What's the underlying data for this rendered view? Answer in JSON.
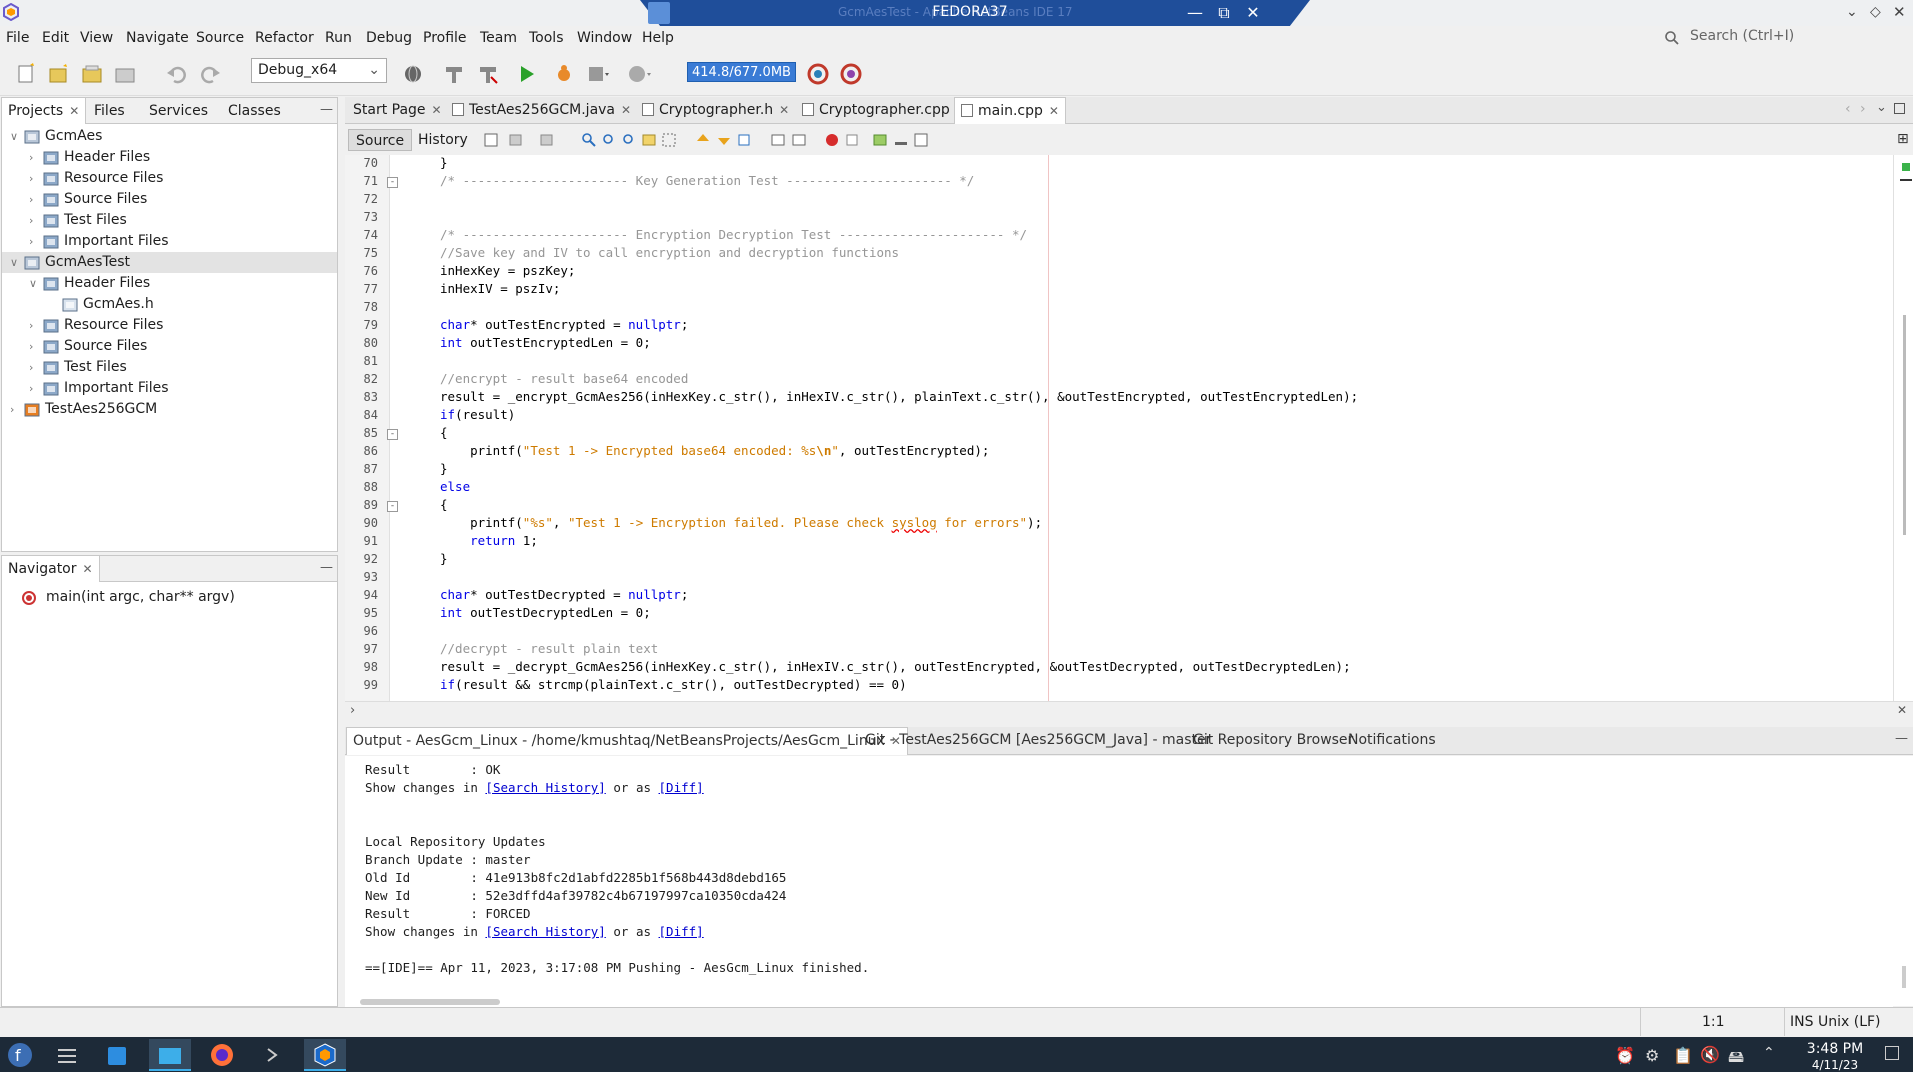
{
  "window": {
    "title": "FEDORA37",
    "title_ghost": "GcmAesTest - Apache NetBeans IDE 17"
  },
  "menubar": {
    "items": [
      "File",
      "Edit",
      "View",
      "Navigate",
      "Source",
      "Refactor",
      "Run",
      "Debug",
      "Profile",
      "Team",
      "Tools",
      "Window",
      "Help"
    ],
    "search_placeholder": "Search (Ctrl+I)"
  },
  "toolbar": {
    "config": "Debug_x64",
    "memory": "414.8/677.0MB"
  },
  "projects_panel": {
    "tabs": [
      "Projects",
      "Files",
      "Services",
      "Classes"
    ],
    "tree": [
      {
        "label": "GcmAes",
        "level": 0,
        "expanded": true,
        "icon": "project-icon"
      },
      {
        "label": "Header Files",
        "level": 1,
        "expanded": false,
        "icon": "folder-icon"
      },
      {
        "label": "Resource Files",
        "level": 1,
        "expanded": false,
        "icon": "folder-icon"
      },
      {
        "label": "Source Files",
        "level": 1,
        "expanded": false,
        "icon": "folder-icon"
      },
      {
        "label": "Test Files",
        "level": 1,
        "expanded": false,
        "icon": "folder-icon"
      },
      {
        "label": "Important Files",
        "level": 1,
        "expanded": false,
        "icon": "folder-icon"
      },
      {
        "label": "GcmAesTest",
        "level": 0,
        "expanded": true,
        "icon": "project-icon",
        "selected": true
      },
      {
        "label": "Header Files",
        "level": 1,
        "expanded": true,
        "icon": "folder-icon"
      },
      {
        "label": "GcmAes.h",
        "level": 2,
        "expanded": null,
        "icon": "header-file-icon"
      },
      {
        "label": "Resource Files",
        "level": 1,
        "expanded": false,
        "icon": "folder-icon"
      },
      {
        "label": "Source Files",
        "level": 1,
        "expanded": false,
        "icon": "folder-icon"
      },
      {
        "label": "Test Files",
        "level": 1,
        "expanded": false,
        "icon": "folder-icon"
      },
      {
        "label": "Important Files",
        "level": 1,
        "expanded": false,
        "icon": "folder-icon"
      },
      {
        "label": "TestAes256GCM",
        "level": 0,
        "expanded": false,
        "icon": "java-project-icon"
      }
    ]
  },
  "navigator_panel": {
    "title": "Navigator",
    "items": [
      "main(int argc, char** argv)"
    ]
  },
  "editor": {
    "tabs": [
      {
        "label": "Start Page"
      },
      {
        "label": "TestAes256GCM.java"
      },
      {
        "label": "Cryptographer.h"
      },
      {
        "label": "Cryptographer.cpp"
      },
      {
        "label": "main.cpp",
        "active": true
      }
    ],
    "source_label": "Source",
    "history_label": "History",
    "lines": [
      {
        "n": "70",
        "html": "}"
      },
      {
        "n": "71",
        "html": "<span class=\"cm\">/* ---------------------- Key Generation Test ---------------------- */</span>",
        "fold": "-"
      },
      {
        "n": "72",
        "html": ""
      },
      {
        "n": "73",
        "html": ""
      },
      {
        "n": "74",
        "html": "<span class=\"cm\">/* ---------------------- Encryption Decryption Test ---------------------- */</span>"
      },
      {
        "n": "75",
        "html": "<span class=\"cm\">//Save key and IV to call encryption and decryption functions</span>"
      },
      {
        "n": "76",
        "html": "inHexKey = pszKey;"
      },
      {
        "n": "77",
        "html": "inHexIV = pszIv;"
      },
      {
        "n": "78",
        "html": ""
      },
      {
        "n": "79",
        "html": "<span class=\"kw\">char</span>* outTestEncrypted = <span class=\"kw\">nullptr</span>;"
      },
      {
        "n": "80",
        "html": "<span class=\"kw\">int</span> outTestEncryptedLen = 0;"
      },
      {
        "n": "81",
        "html": ""
      },
      {
        "n": "82",
        "html": "<span class=\"cm\">//encrypt - result base64 encoded</span>"
      },
      {
        "n": "83",
        "html": "result = _encrypt_GcmAes256(inHexKey.c_str(), inHexIV.c_str(), plainText.c_str(), &amp;outTestEncrypted, outTestEncryptedLen);"
      },
      {
        "n": "84",
        "html": "<span class=\"kw\">if</span>(result)"
      },
      {
        "n": "85",
        "html": "{",
        "fold": "-"
      },
      {
        "n": "86",
        "html": "    printf(<span class=\"str\">\"Test 1 -&gt; Encrypted base64 encoded: %s</span><span class=\"esc\">\\n</span><span class=\"str\">\"</span>, outTestEncrypted);"
      },
      {
        "n": "87",
        "html": "}"
      },
      {
        "n": "88",
        "html": "<span class=\"kw\">else</span>"
      },
      {
        "n": "89",
        "html": "{",
        "fold": "-"
      },
      {
        "n": "90",
        "html": "    printf(<span class=\"str\">\"%s\"</span>, <span class=\"str\">\"Test 1 -&gt; Encryption failed. Please check <span class=\"sq\">syslog</span> for errors\"</span>);"
      },
      {
        "n": "91",
        "html": "    <span class=\"kw\">return</span> 1;"
      },
      {
        "n": "92",
        "html": "}"
      },
      {
        "n": "93",
        "html": ""
      },
      {
        "n": "94",
        "html": "<span class=\"kw\">char</span>* outTestDecrypted = <span class=\"kw\">nullptr</span>;"
      },
      {
        "n": "95",
        "html": "<span class=\"kw\">int</span> outTestDecryptedLen = 0;"
      },
      {
        "n": "96",
        "html": ""
      },
      {
        "n": "97",
        "html": "<span class=\"cm\">//decrypt - result plain text</span>"
      },
      {
        "n": "98",
        "html": "result = _decrypt_GcmAes256(inHexKey.c_str(), inHexIV.c_str(), outTestEncrypted, &amp;outTestDecrypted, outTestDecryptedLen);"
      },
      {
        "n": "99",
        "html": "<span class=\"kw\">if</span>(result &amp;&amp; strcmp(plainText.c_str(), outTestDecrypted) == 0)"
      }
    ]
  },
  "output": {
    "tabs": [
      {
        "label": "Output - AesGcm_Linux - /home/kmushtaq/NetBeansProjects/AesGcm_Linux",
        "active": true
      },
      {
        "label": "Git - TestAes256GCM [Aes256GCM_Java] - master"
      },
      {
        "label": "Git Repository Browser"
      },
      {
        "label": "Notifications"
      }
    ],
    "lines": [
      {
        "text": "Result        : OK"
      },
      {
        "pre": "Show changes in ",
        "link1": "[Search History]",
        "mid": " or as ",
        "link2": "[Diff]"
      },
      {
        "text": ""
      },
      {
        "text": ""
      },
      {
        "text": "Local Repository Updates"
      },
      {
        "text": "Branch Update : master"
      },
      {
        "text": "Old Id        : 41e913b8fc2d1abfd2285b1f568b443d8debd165"
      },
      {
        "text": "New Id        : 52e3dffd4af39782c4b67197997ca10350cda424"
      },
      {
        "text": "Result        : FORCED"
      },
      {
        "pre": "Show changes in ",
        "link1": "[Search History]",
        "mid": " or as ",
        "link2": "[Diff]"
      },
      {
        "text": ""
      },
      {
        "text": "==[IDE]== Apr 11, 2023, 3:17:08 PM Pushing - AesGcm_Linux finished."
      }
    ]
  },
  "statusbar": {
    "position": "1:1",
    "mode": "INS",
    "line_ending": "Unix (LF)"
  },
  "taskbar": {
    "time": "3:48 PM",
    "date": "4/11/23"
  }
}
